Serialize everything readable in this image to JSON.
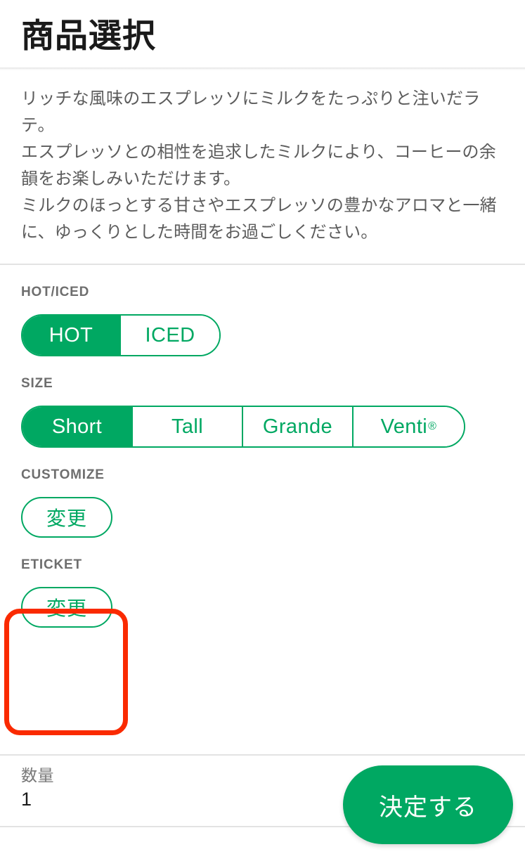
{
  "header": {
    "title": "商品選択"
  },
  "description": {
    "lines": [
      "リッチな風味のエスプレッソにミルクをたっぷりと注いだラテ。",
      "エスプレッソとの相性を追求したミルクにより、コーヒーの余韻をお楽しみいただけます。",
      "ミルクのほっとする甘さやエスプレッソの豊かなアロマと一緒に、ゆっくりとした時間をお過ごしください。"
    ],
    "text": "リッチな風味のエスプレッソにミルクをたっぷりと注いだラテ。\nエスプレッソとの相性を追求したミルクにより、コーヒーの余韻をお楽しみいただけます。\nミルクのほっとする甘さやエスプレッソの豊かなアロマと一緒に、ゆっくりとした時間をお過ごしください。"
  },
  "sections": {
    "hot_iced": {
      "label": "HOT/ICED",
      "options": [
        {
          "label": "HOT",
          "selected": true
        },
        {
          "label": "ICED",
          "selected": false
        }
      ]
    },
    "size": {
      "label": "SIZE",
      "options": [
        {
          "label": "Short",
          "selected": true
        },
        {
          "label": "Tall",
          "selected": false
        },
        {
          "label": "Grande",
          "selected": false
        },
        {
          "label": "Venti",
          "trademark": "®",
          "selected": false
        }
      ]
    },
    "customize": {
      "label": "CUSTOMIZE",
      "change_button": "変更"
    },
    "eticket": {
      "label": "ETICKET",
      "change_button": "変更",
      "highlighted": true
    }
  },
  "bottom_bar": {
    "quantity_label": "数量",
    "quantity_value": "1",
    "confirm_label": "決定する"
  },
  "colors": {
    "brand_green": "#00a862",
    "annotation_red": "#fa2a00",
    "label_grey": "#6e6e6e",
    "body_grey": "#5c5c5c",
    "divider": "#e3e3e3"
  }
}
